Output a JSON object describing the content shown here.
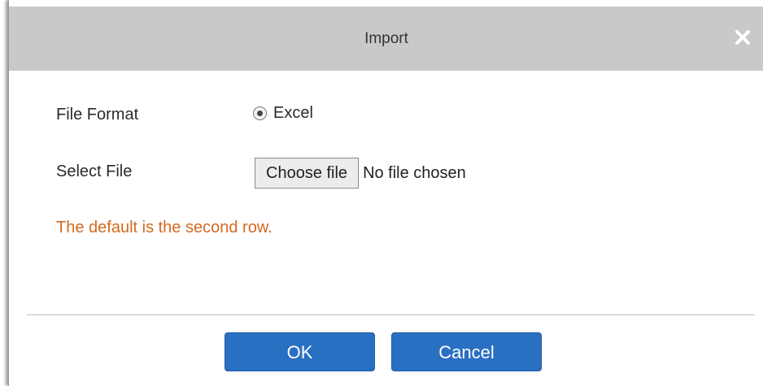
{
  "dialog": {
    "title": "Import",
    "close_icon": "close-icon"
  },
  "form": {
    "file_format_label": "File Format",
    "file_format_option": "Excel",
    "select_file_label": "Select File",
    "choose_file_button": "Choose file",
    "no_file_text": "No file chosen",
    "note": "The default is the second row."
  },
  "footer": {
    "ok_label": "OK",
    "cancel_label": "Cancel"
  },
  "colors": {
    "titlebar": "#c9c9c9",
    "note": "#d2691e",
    "primary_button": "#2a70c2"
  }
}
